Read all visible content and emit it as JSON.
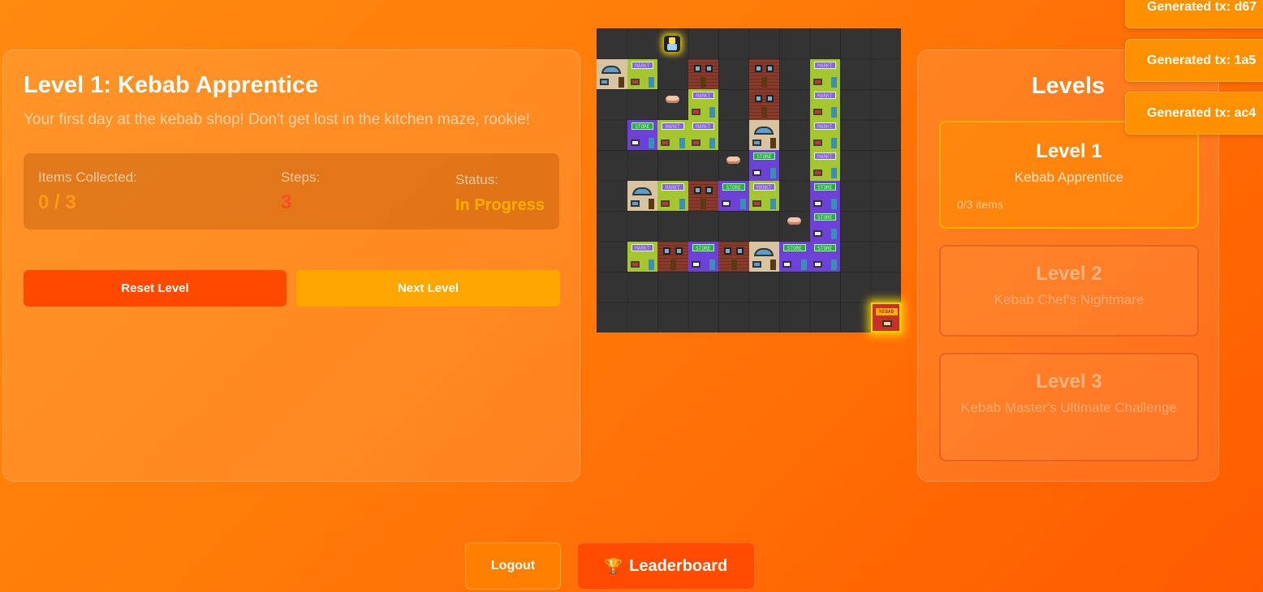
{
  "level_info": {
    "title": "Level 1: Kebab Apprentice",
    "description": "Your first day at the kebab shop! Don't get lost in the kitchen maze, rookie!",
    "stats": {
      "items_label": "Items Collected:",
      "items_value": "0 / 3",
      "steps_label": "Steps:",
      "steps_value": "3",
      "status_label": "Status:",
      "status_value": "In Progress"
    },
    "reset_label": "Reset Level",
    "next_label": "Next Level"
  },
  "board": {
    "grid_size": 10,
    "player_cell": [
      2,
      1
    ],
    "goal_cell": [
      9,
      9
    ],
    "goal_sign": "KEBAB",
    "item_cells": [
      [
        2,
        2
      ],
      [
        4,
        4
      ],
      [
        6,
        6
      ]
    ],
    "buildings": [
      {
        "type": "house",
        "cell": [
          0,
          1
        ]
      },
      {
        "type": "market",
        "cell": [
          1,
          1
        ],
        "sign": "MARKT"
      },
      {
        "type": "brick",
        "cell": [
          3,
          1
        ]
      },
      {
        "type": "brick",
        "cell": [
          5,
          1
        ]
      },
      {
        "type": "market",
        "cell": [
          7,
          1
        ],
        "sign": "MARKT"
      },
      {
        "type": "market",
        "cell": [
          3,
          2
        ],
        "sign": "MARKT"
      },
      {
        "type": "brick",
        "cell": [
          5,
          2
        ]
      },
      {
        "type": "market",
        "cell": [
          7,
          2
        ],
        "sign": "MARKT"
      },
      {
        "type": "store",
        "cell": [
          1,
          3
        ],
        "sign": "STORE"
      },
      {
        "type": "market",
        "cell": [
          2,
          3
        ],
        "sign": "MARKT"
      },
      {
        "type": "market",
        "cell": [
          3,
          3
        ],
        "sign": "MARKT"
      },
      {
        "type": "house",
        "cell": [
          5,
          3
        ]
      },
      {
        "type": "market",
        "cell": [
          7,
          3
        ],
        "sign": "MARKT"
      },
      {
        "type": "store",
        "cell": [
          5,
          4
        ],
        "sign": "STORE"
      },
      {
        "type": "market",
        "cell": [
          7,
          4
        ],
        "sign": "MARKT"
      },
      {
        "type": "house",
        "cell": [
          1,
          5
        ]
      },
      {
        "type": "market",
        "cell": [
          2,
          5
        ],
        "sign": "MARKT"
      },
      {
        "type": "brick",
        "cell": [
          3,
          5
        ]
      },
      {
        "type": "store",
        "cell": [
          4,
          5
        ],
        "sign": "STORE"
      },
      {
        "type": "market",
        "cell": [
          5,
          5
        ],
        "sign": "MARKT"
      },
      {
        "type": "store",
        "cell": [
          7,
          5
        ],
        "sign": "STORE"
      },
      {
        "type": "store",
        "cell": [
          7,
          6
        ],
        "sign": "STORE"
      },
      {
        "type": "market",
        "cell": [
          1,
          7
        ],
        "sign": "MARKT"
      },
      {
        "type": "brick",
        "cell": [
          2,
          7
        ]
      },
      {
        "type": "store",
        "cell": [
          3,
          7
        ],
        "sign": "STORE"
      },
      {
        "type": "brick",
        "cell": [
          4,
          7
        ]
      },
      {
        "type": "house",
        "cell": [
          5,
          7
        ]
      },
      {
        "type": "store",
        "cell": [
          6,
          7
        ],
        "sign": "STORE"
      },
      {
        "type": "store",
        "cell": [
          7,
          7
        ],
        "sign": "STORE"
      }
    ]
  },
  "levels_panel": {
    "title": "Levels",
    "levels": [
      {
        "title": "Level 1",
        "subtitle": "Kebab Apprentice",
        "items": "0/3 items"
      },
      {
        "title": "Level 2",
        "subtitle": "Kebab Chef's Nightmare"
      },
      {
        "title": "Level 3",
        "subtitle": "Kebab Master's Ultimate Challenge"
      }
    ]
  },
  "toasts": [
    "Generated tx: d67",
    "Generated tx: 1a5",
    "Generated tx: ac4"
  ],
  "footer": {
    "logout_label": "Logout",
    "leaderboard_icon": "🏆",
    "leaderboard_label": "Leaderboard"
  },
  "colors": {
    "background": "#ff7a08",
    "reset_button": "#ff4800",
    "next_button": "#ffa600",
    "active_level_border": "#ffb000"
  }
}
